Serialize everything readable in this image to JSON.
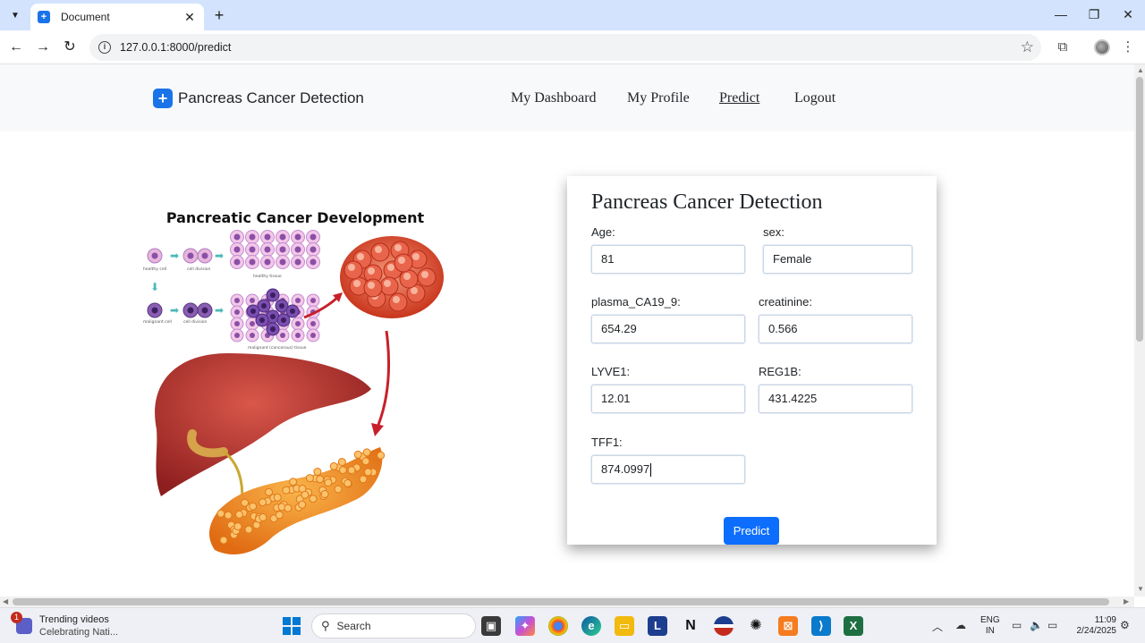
{
  "browser": {
    "tab_title": "Document",
    "url": "127.0.0.1:8000/predict"
  },
  "navbar": {
    "brand": "Pancreas Cancer Detection",
    "links": [
      {
        "label": "My Dashboard",
        "active": false
      },
      {
        "label": "My Profile",
        "active": false
      },
      {
        "label": "Predict",
        "active": true
      },
      {
        "label": "Logout",
        "active": false
      }
    ]
  },
  "illustration": {
    "title": "Pancreatic Cancer Development",
    "labels": {
      "healthy_cell": "healthy cell",
      "cell_division_1": "cell division",
      "healthy_tissue": "healthy tissue",
      "malignant_cell": "malignant cell",
      "cell_division_2": "cell division",
      "malignant_tissue": "malignant (cancerous) tissue"
    }
  },
  "form": {
    "title": "Pancreas Cancer Detection",
    "fields": {
      "age": {
        "label": "Age:",
        "value": "81"
      },
      "sex": {
        "label": "sex:",
        "value": "Female"
      },
      "plasma": {
        "label": "plasma_CA19_9:",
        "value": "654.29"
      },
      "creatinine": {
        "label": "creatinine:",
        "value": "0.566"
      },
      "lyve1": {
        "label": "LYVE1:",
        "value": "12.01"
      },
      "reg1b": {
        "label": "REG1B:",
        "value": "431.4225"
      },
      "tff1": {
        "label": "TFF1:",
        "value": "874.0997"
      }
    },
    "submit_label": "Predict"
  },
  "taskbar": {
    "widget_title": "Trending videos",
    "widget_subtitle": "Celebrating Nati...",
    "widget_badge": "1",
    "search_placeholder": "Search",
    "lang_line1": "ENG",
    "lang_line2": "IN",
    "time": "11:09",
    "date": "2/24/2025"
  },
  "colors": {
    "accent": "#0d6efd",
    "navbar_bg": "#f8f9fa",
    "tabbar_bg": "#d3e3fd"
  }
}
